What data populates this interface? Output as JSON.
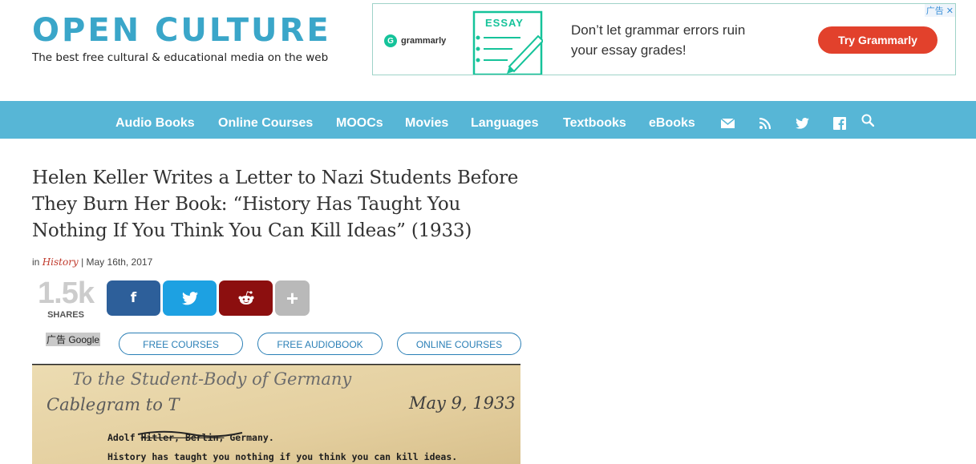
{
  "header": {
    "logo_title": "OPEN CULTURE",
    "logo_tagline": "The best free cultural & educational media on the web"
  },
  "ad": {
    "badge": "广告",
    "close": "✕",
    "brand": "grammarly",
    "brand_initial": "G",
    "essay_label": "ESSAY",
    "copy_line1": "Don’t let grammar errors ruin",
    "copy_line2": "your essay grades!",
    "cta": "Try Grammarly"
  },
  "nav": {
    "items": [
      "Audio Books",
      "Online Courses",
      "MOOCs",
      "Movies",
      "Languages",
      "Textbooks",
      "eBooks"
    ],
    "icons": [
      "mail-icon",
      "rss-icon",
      "twitter-icon",
      "facebook-icon",
      "search-icon"
    ]
  },
  "article": {
    "title": "Helen Keller Writes a Letter to Nazi Students Before They Burn Her Book: “History Has Taught You Nothing If You Think You Can Kill Ideas” (1933)",
    "meta_prefix": "in",
    "category": "History",
    "date": "| May 16th, 2017"
  },
  "share": {
    "count": "1.5k",
    "label": "SHARES",
    "buttons": [
      {
        "name": "facebook",
        "glyph": "f",
        "color": "#2d5f9a"
      },
      {
        "name": "twitter",
        "glyph": "",
        "color": "#1da1e2"
      },
      {
        "name": "reddit",
        "glyph": "",
        "color": "#8c0f0f"
      },
      {
        "name": "more",
        "glyph": "+",
        "color": "#b9b9b9"
      }
    ]
  },
  "ad_label": "广告 Google",
  "pills": [
    "FREE COURSES",
    "FREE AUDIOBOOK",
    "ONLINE COURSES"
  ],
  "letter": {
    "line1": "To the Student-Body of Germany",
    "line2": "Cablegram to T",
    "date": "May 9, 1933",
    "addressee_prefix": "Adolf",
    "addressee_struck": "Hitler, Berlin,",
    "addressee_suffix": "Germany.",
    "body": "History has taught you nothing if you think you can kill ideas."
  }
}
